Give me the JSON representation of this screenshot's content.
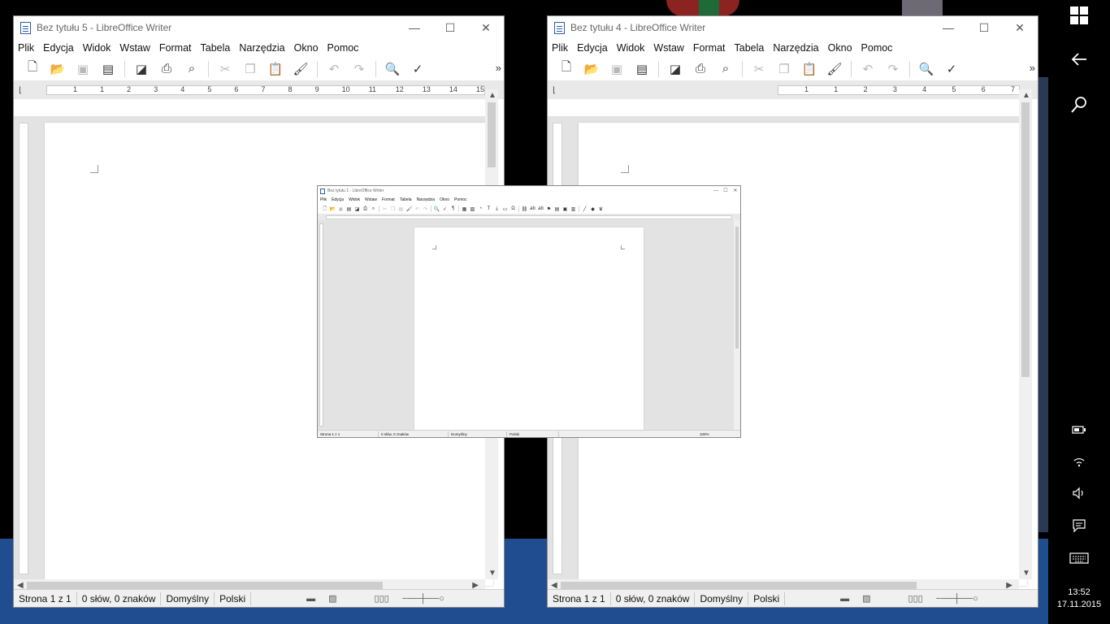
{
  "windows": [
    {
      "title": "Bez tytułu 5 - LibreOffice Writer",
      "menus": [
        "Plik",
        "Edycja",
        "Widok",
        "Wstaw",
        "Format",
        "Tabela",
        "Narzędzia",
        "Okno",
        "Pomoc"
      ],
      "ruler_numbers": [
        "1",
        "1",
        "2",
        "3",
        "4",
        "5",
        "6",
        "7",
        "8",
        "9",
        "10",
        "11",
        "12",
        "13",
        "14",
        "15"
      ],
      "status": {
        "page": "Strona 1 z 1",
        "words": "0 słów, 0 znaków",
        "style": "Domyślny",
        "language": "Polski"
      }
    },
    {
      "title": "Bez tytułu 4 - LibreOffice Writer",
      "menus": [
        "Plik",
        "Edycja",
        "Widok",
        "Wstaw",
        "Format",
        "Tabela",
        "Narzędzia",
        "Okno",
        "Pomoc"
      ],
      "ruler_numbers": [
        "1",
        "1",
        "2",
        "3",
        "4",
        "5",
        "6",
        "7"
      ],
      "status": {
        "page": "Strona 1 z 1",
        "words": "0 słów, 0 znaków",
        "style": "Domyślny",
        "language": "Polski"
      }
    },
    {
      "title": "Bez tytułu 1 - LibreOffice Writer",
      "menus": [
        "Plik",
        "Edycja",
        "Widok",
        "Wstaw",
        "Format",
        "Tabela",
        "Narzędzia",
        "Okno",
        "Pomoc"
      ],
      "status": {
        "page": "Strona 1 z 1",
        "words": "0 słów, 0 znaków",
        "style": "Domyślny",
        "language": "Polski",
        "zoom": "100%"
      }
    }
  ],
  "window_controls": {
    "minimize": "—",
    "maximize": "☐",
    "close": "✕"
  },
  "toolbar_overflow": "»",
  "clock": {
    "time": "13:52",
    "date": "17.11.2015"
  },
  "icons": [
    "windows-logo-icon",
    "back-arrow-icon",
    "search-icon",
    "battery-icon",
    "wifi-icon",
    "volume-icon",
    "notifications-icon",
    "keyboard-icon"
  ]
}
